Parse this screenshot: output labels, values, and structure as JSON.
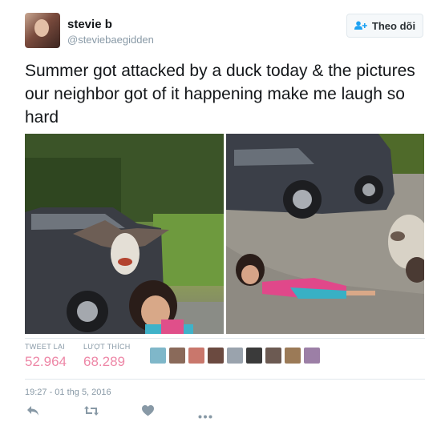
{
  "user": {
    "display_name": "stevie b",
    "handle": "@steviebaegidden"
  },
  "follow_button": {
    "label": "Theo dõi"
  },
  "tweet": {
    "text": "Summer got attacked by a duck today & the pictures our neighbor got of it happening make me laugh so hard"
  },
  "stats": {
    "retweets_label": "TWEET LẠI",
    "retweets_value": "52.964",
    "likes_label": "LƯỢT THÍCH",
    "likes_value": "68.289"
  },
  "liker_avatar_colors": [
    "#7fb7c9",
    "#8a6a5a",
    "#c9776c",
    "#6b4a40",
    "#9aa3ad",
    "#3a3a3a",
    "#6c5a52",
    "#9b7a57",
    "#9c7fa6"
  ],
  "timestamp": "19:27 - 01 thg 5, 2016",
  "actions": {
    "reply": "reply-icon",
    "retweet": "retweet-icon",
    "like": "heart-icon",
    "more": "more-icon"
  },
  "colors": {
    "likes_accent": "#e0245e",
    "muted": "#8899a6"
  }
}
